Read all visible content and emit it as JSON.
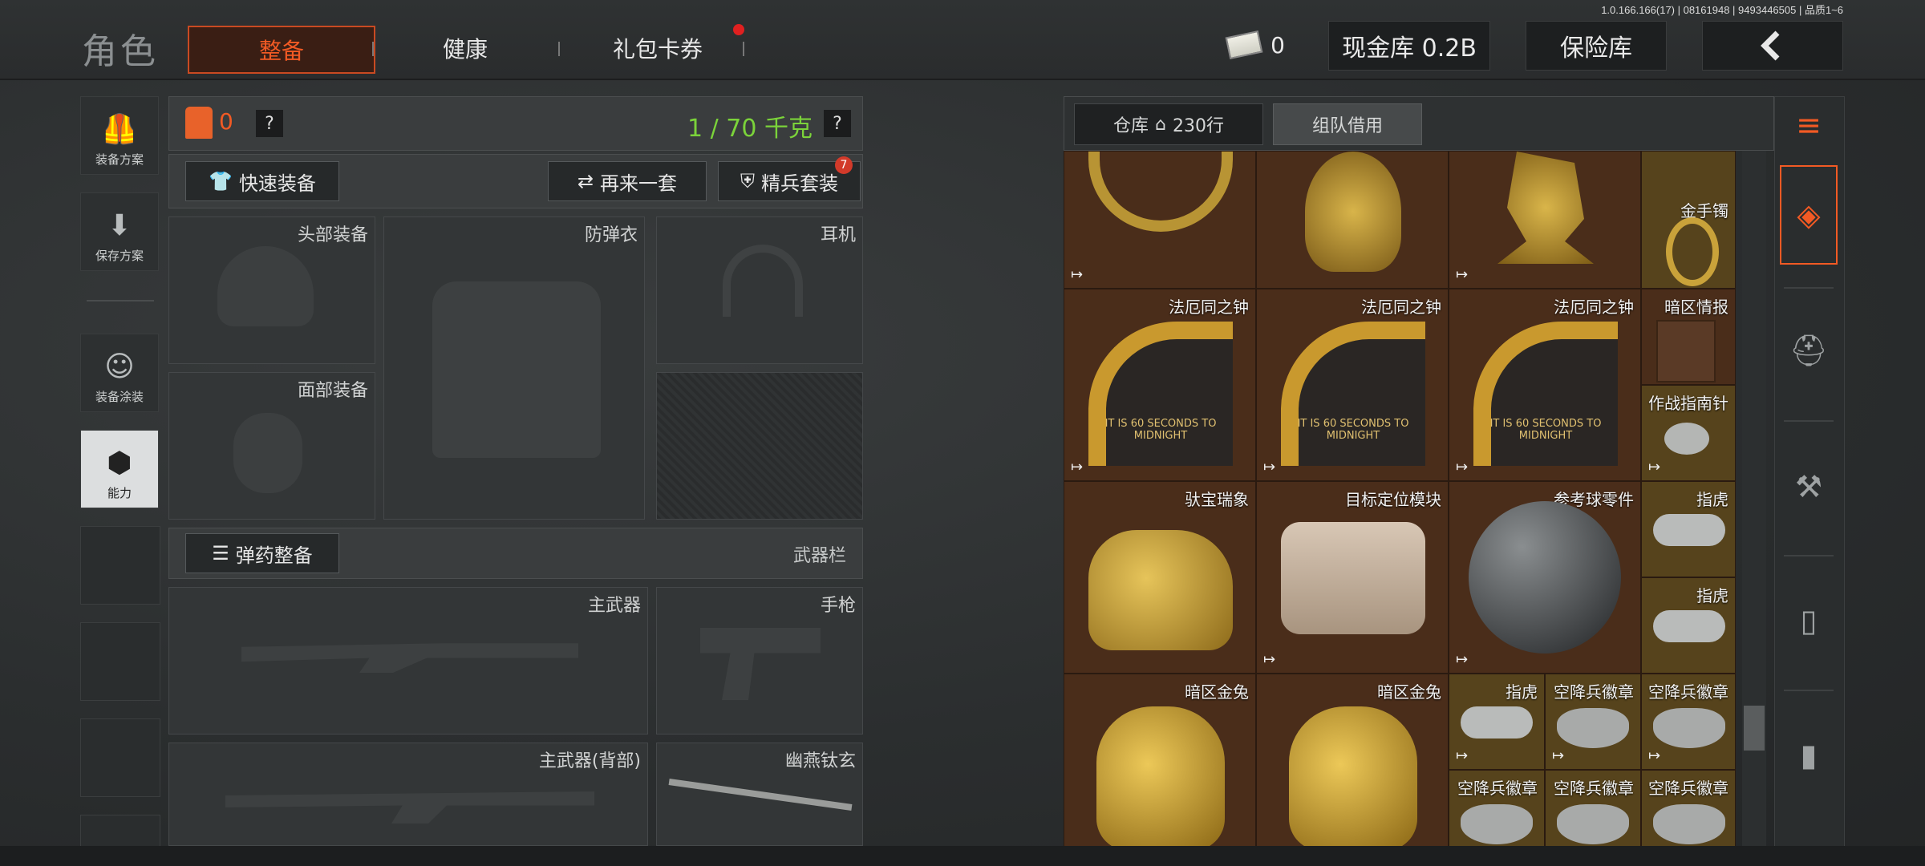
{
  "header": {
    "title": "角色",
    "tabs": [
      "整备",
      "健康",
      "礼包卡券"
    ],
    "version": "1.0.166.166(17) | 08161948 | 9493446505 | 品质1~6",
    "cash": "0",
    "cash_vault": "现金库 0.2B",
    "insurance": "保险库",
    "back_icon": "chevron-left-icon"
  },
  "sidebar": {
    "items": [
      {
        "label": "装备方案",
        "icon": "vest-icon"
      },
      {
        "label": "保存方案",
        "icon": "download-icon"
      },
      {
        "label": "装备涂装",
        "icon": "soldier-icon"
      },
      {
        "label": "能力",
        "icon": "lightning-hex-icon"
      }
    ]
  },
  "equipment": {
    "armor_count": "0",
    "weight": "1 / 70 千克",
    "help": "?",
    "quick_equip": "快速装备",
    "again": "再来一套",
    "elite": "精兵套装",
    "elite_badge": "7",
    "slots": {
      "head": "头部装备",
      "body": "防弹衣",
      "earphone": "耳机",
      "face": "面部装备"
    },
    "ammo": "弹药整备",
    "weapon_bar": "武器栏",
    "weapons": {
      "primary": "主武器",
      "pistol": "手枪",
      "primary_back": "主武器(背部)",
      "melee": "幽燕钛玄"
    }
  },
  "warehouse": {
    "tab_label": "仓库",
    "rows": "230行",
    "team_borrow": "组队借用",
    "items": {
      "row1_4": "金手镯",
      "bell": "法厄同之钟",
      "intel": "暗区情报",
      "compass": "作战指南针",
      "elephant": "驮宝瑞象",
      "locator": "目标定位模块",
      "sphere": "参考球零件",
      "knuckle": "指虎",
      "rabbit": "暗区金兔",
      "badge": "空降兵徽章",
      "bell_text": "IT IS 60 SECONDS TO MIDNIGHT"
    }
  },
  "colors": {
    "accent": "#f25a24",
    "weight_green": "#7bd33a",
    "cell_brown": "#4a2d1a",
    "cell_gold": "#56431c"
  }
}
